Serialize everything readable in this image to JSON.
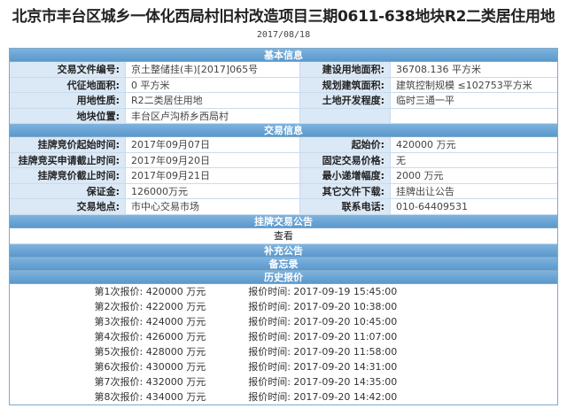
{
  "page": {
    "title": "北京市丰台区城乡一体化西局村旧村改造项目三期0611-638地块R2二类居住用地",
    "date": "2017/08/18"
  },
  "basic": {
    "header": "基本信息",
    "rows": [
      {
        "l1": "交易文件编号:",
        "v1": "京土整储挂(丰)[2017]065号",
        "l2": "建设用地面积:",
        "v2": "36708.136 平方米"
      },
      {
        "l1": "代征地面积:",
        "v1": "0 平方米",
        "l2": "规划建筑面积:",
        "v2": "建筑控制规模 ≤102753平方米"
      },
      {
        "l1": "用地性质:",
        "v1": "R2二类居住用地",
        "l2": "土地开发程度:",
        "v2": "临时三通一平"
      },
      {
        "l1": "地块位置:",
        "v1": "丰台区卢沟桥乡西局村",
        "l2": "",
        "v2": ""
      }
    ]
  },
  "trade": {
    "header": "交易信息",
    "rows": [
      {
        "l1": "挂牌竞价起始时间:",
        "v1": "2017年09月07日",
        "l2": "起始价:",
        "v2": "420000 万元"
      },
      {
        "l1": "挂牌竞买申请截止时间:",
        "v1": "2017年09月20日",
        "l2": "固定交易价格:",
        "v2": "无"
      },
      {
        "l1": "挂牌竞价截止时间:",
        "v1": "2017年09月21日",
        "l2": "最小递增幅度:",
        "v2": "2000 万元"
      },
      {
        "l1": "保证金:",
        "v1": "126000万元",
        "l2": "其它文件下载:",
        "v2": "挂牌出让公告"
      },
      {
        "l1": "交易地点:",
        "v1": "市中心交易市场",
        "l2": "联系电话:",
        "v2": "010-64409531"
      }
    ]
  },
  "announcement": {
    "header": "挂牌交易公告",
    "view_label": "查看"
  },
  "supplement": {
    "header": "补充公告"
  },
  "memo": {
    "header": "备忘录"
  },
  "history": {
    "header": "历史报价",
    "rows": [
      {
        "bid": "第1次报价: 420000 万元",
        "time": "报价时间: 2017-09-19 15:45:00"
      },
      {
        "bid": "第2次报价: 422000 万元",
        "time": "报价时间: 2017-09-20 10:38:00"
      },
      {
        "bid": "第3次报价: 424000 万元",
        "time": "报价时间: 2017-09-20 10:45:00"
      },
      {
        "bid": "第4次报价: 426000 万元",
        "time": "报价时间: 2017-09-20 11:07:00"
      },
      {
        "bid": "第5次报价: 428000 万元",
        "time": "报价时间: 2017-09-20 11:58:00"
      },
      {
        "bid": "第6次报价: 430000 万元",
        "time": "报价时间: 2017-09-20 14:31:00"
      },
      {
        "bid": "第7次报价: 432000 万元",
        "time": "报价时间: 2017-09-20 14:35:00"
      },
      {
        "bid": "第8次报价: 434000 万元",
        "time": "报价时间: 2017-09-20 14:42:00"
      }
    ]
  }
}
